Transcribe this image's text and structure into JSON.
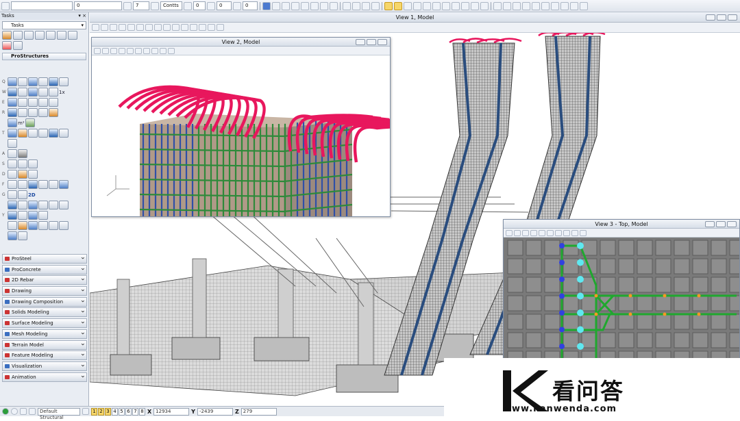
{
  "toolbar": {
    "level_dropdown": "",
    "zero_dropdown": "0",
    "contents_dropdown": "Contts",
    "weight_value": "7",
    "style_value": "0",
    "priority_value": "0",
    "transparency_value": "0"
  },
  "tasks_panel": {
    "title": "Tasks",
    "selected_task": "Tasks",
    "prostructures_header": "ProStructures",
    "row_letters": [
      "Q",
      "W",
      "E",
      "R",
      "T",
      "A",
      "S",
      "D",
      "F",
      "G",
      "Y"
    ],
    "tool_labels": {
      "m2": "m²",
      "one_x": "1x",
      "two_d": "2D"
    },
    "task_groups": [
      "ProSteel",
      "ProConcrete",
      "2D Rebar",
      "Drawing",
      "Drawing Composition",
      "Solids Modeling",
      "Surface Modeling",
      "Mesh Modeling",
      "Terrain Model",
      "Feature Modeling",
      "Visualization",
      "Animation"
    ]
  },
  "views": {
    "view1_title": "View 1, Model",
    "view2_title": "View 2, Model",
    "view3_title": "View 3 - Top, Model"
  },
  "status_bar": {
    "level_name": "Default Structural",
    "view_numbers": [
      "1",
      "2",
      "3",
      "4",
      "5",
      "6",
      "7",
      "8"
    ],
    "active_views": 3,
    "x_label": "X",
    "x_value": "12934",
    "y_label": "Y",
    "y_value": "-2439",
    "z_label": "Z",
    "z_value": "279"
  },
  "watermark": {
    "chinese_text": "看问答",
    "url_text": "www.kanwenda.com"
  },
  "colors": {
    "rebar_hook": "#e8175d",
    "rebar_vertical": "#2f4fa8",
    "rebar_horizontal": "#2e8a3a",
    "top_view_green": "#1fa82e",
    "top_view_cyan": "#5fe8f0",
    "top_view_blue": "#3141e0",
    "top_view_orange": "#f39a22"
  }
}
